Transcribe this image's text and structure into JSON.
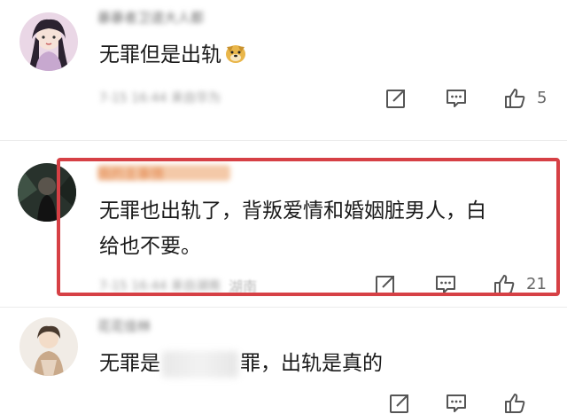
{
  "comments": [
    {
      "username": "暴暴者卫道大人都",
      "text": "无罪但是出轨",
      "emoji": "doge-emoji",
      "meta": "7-15 16:44  来自华为",
      "like_count": "5"
    },
    {
      "username": "我的主事情",
      "text_line1": "无罪也出轨了，背叛爱情和婚姻脏男人，白",
      "text_line2": "给也不要。",
      "meta": "7-15 16:44  来自湖南",
      "meta_extra": "湖南",
      "like_count": "21"
    },
    {
      "username": "花花佳林",
      "text_before": "无罪是",
      "text_after": "罪，出轨是真的"
    }
  ],
  "icons": {
    "share": "share-icon",
    "comment": "comment-icon",
    "like": "thumbs-up-icon"
  },
  "colors": {
    "highlight": "#d64045"
  }
}
